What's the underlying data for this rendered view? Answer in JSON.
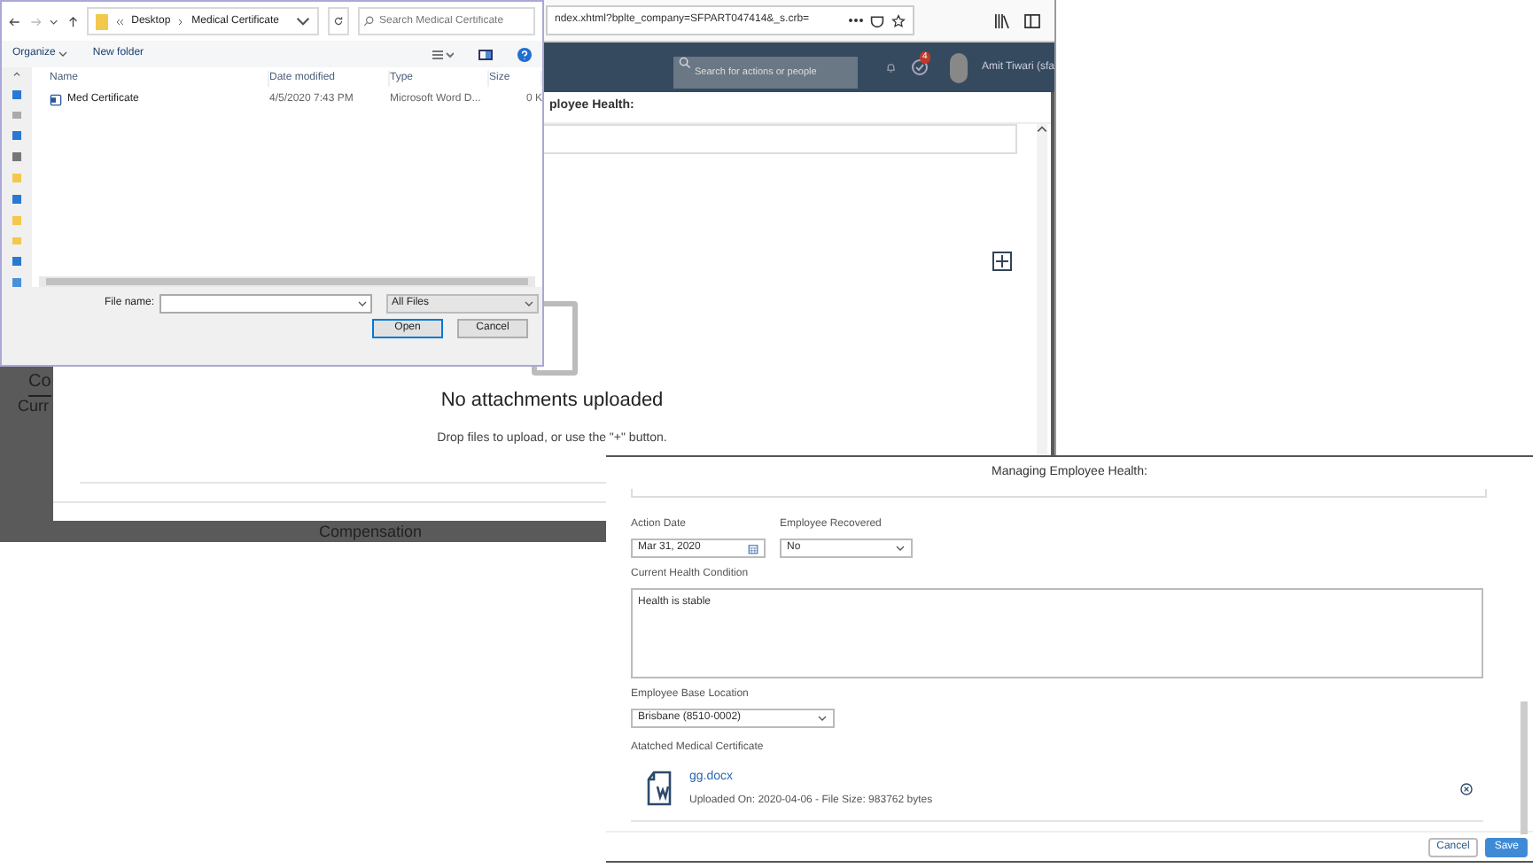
{
  "browser": {
    "url": "ndex.xhtml?bplte_company=SFPART047414&_s.crb=",
    "search": {
      "placeholder": "Search for actions or people"
    },
    "notification_count": "4",
    "user_name": "Amit Tiwari (sfa"
  },
  "background_page": {
    "labels": [
      "Co",
      "Curr",
      "Compensation"
    ]
  },
  "attachments_dialog": {
    "title": "ployee Health:",
    "empty_title": "No attachments uploaded",
    "empty_hint": "Drop files to upload, or use the \"+\" button."
  },
  "file_dialog": {
    "path": [
      "Desktop",
      "Medical Certificate"
    ],
    "search": {
      "placeholder": "Search Medical Certificate"
    },
    "toolbar": [
      "Organize",
      "New folder"
    ],
    "columns": [
      "Name",
      "Date modified",
      "Type",
      "Size"
    ],
    "rows": [
      {
        "name": "Med Certificate",
        "date": "4/5/2020 7:43 PM",
        "type": "Microsoft Word D...",
        "size": "0 K"
      }
    ],
    "file_name_label": "File name:",
    "file_type": "All Files",
    "buttons": [
      {
        "label": "Open",
        "kind": "default"
      },
      {
        "label": "Cancel",
        "kind": "normal"
      }
    ]
  },
  "health_form": {
    "title": "Managing Employee Health:",
    "rows": [
      [
        {
          "label": "Action Date",
          "value": "Mar 31, 2020",
          "kind": "date"
        },
        {
          "label": "Employee Recovered",
          "value": "No",
          "kind": "select"
        }
      ],
      [
        {
          "label": "Current Health Condition",
          "value": "Health is stable",
          "kind": "textarea"
        }
      ],
      [
        {
          "label": "Employee Base Location",
          "value": "Brisbane (8510-0002)",
          "kind": "select"
        }
      ]
    ],
    "attachment_label": "Atatched Medical Certificate",
    "attachment": {
      "name": "gg.docx",
      "meta": "Uploaded On: 2020-04-06 - File Size: 983762 bytes"
    },
    "buttons": [
      {
        "label": "Cancel",
        "kind": "secondary"
      },
      {
        "label": "Save",
        "kind": "primary"
      }
    ]
  }
}
